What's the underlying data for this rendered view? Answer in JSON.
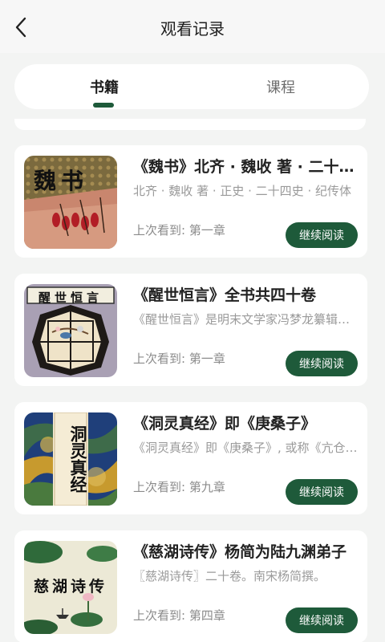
{
  "header": {
    "title": "观看记录",
    "back_icon": "chevron-left-icon"
  },
  "tabs": [
    {
      "label": "书籍",
      "active": true
    },
    {
      "label": "课程",
      "active": false
    }
  ],
  "theme": {
    "accent": "#1e5a3a"
  },
  "books": [
    {
      "title": "《魏书》北齐 · 魏收 著 · 二十四史",
      "description": "北齐 · 魏收 著 · 正史 · 二十四史 · 纪传体",
      "last_read": "上次看到: 第一章",
      "button": "继续阅读",
      "cover_text": "魏书"
    },
    {
      "title": "《醒世恒言》全书共四十卷",
      "description": "《醒世恒言》是明末文学家冯梦龙纂辑的白话短篇小说集",
      "last_read": "上次看到: 第一章",
      "button": "继续阅读",
      "cover_text": "醒世恒言"
    },
    {
      "title": "《洞灵真经》即《庚桑子》",
      "description": "《洞灵真经》即《庚桑子》, 或称《亢仓子》",
      "last_read": "上次看到: 第九章",
      "button": "继续阅读",
      "cover_text": "洞灵真经"
    },
    {
      "title": "《慈湖诗传》杨简为陆九渊弟子",
      "description": "〖慈湖诗传〗二十卷。南宋杨简撰。",
      "last_read": "上次看到: 第四章",
      "button": "继续阅读",
      "cover_text": "慈湖诗传"
    }
  ]
}
